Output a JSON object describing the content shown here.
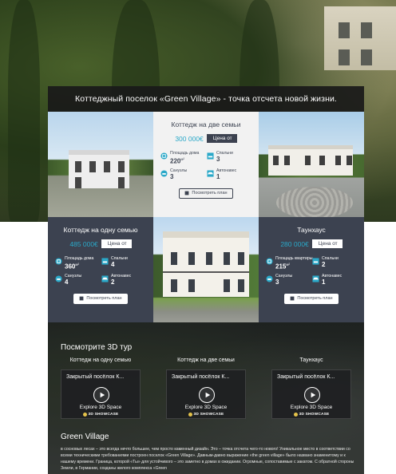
{
  "banner": {
    "title": "Коттеджный поселок «Green Village» - точка отсчета новой жизни."
  },
  "cards": [
    {
      "title": "Коттедж на две семьи",
      "price": "300 000€",
      "price_label": "Цена от",
      "specs": [
        {
          "label": "Площадь дома",
          "value": "220",
          "unit": "м²",
          "icon": "area-icon"
        },
        {
          "label": "Спальни",
          "value": "3",
          "unit": "",
          "icon": "bed-icon"
        },
        {
          "label": "Санузлы",
          "value": "3",
          "unit": "",
          "icon": "bath-icon"
        },
        {
          "label": "Автонавес",
          "value": "1",
          "unit": "",
          "icon": "car-icon"
        }
      ],
      "button": "Посмотреть план"
    },
    {
      "title": "Коттедж на одну семью",
      "price": "485 000€",
      "price_label": "Цена от",
      "specs": [
        {
          "label": "Площадь дома",
          "value": "360",
          "unit": "м²",
          "icon": "area-icon"
        },
        {
          "label": "Спальни",
          "value": "4",
          "unit": "",
          "icon": "bed-icon"
        },
        {
          "label": "Санузлы",
          "value": "4",
          "unit": "",
          "icon": "bath-icon"
        },
        {
          "label": "Автонавес",
          "value": "2",
          "unit": "",
          "icon": "car-icon"
        }
      ],
      "button": "Посмотреть план"
    },
    {
      "title": "Таунхаус",
      "price": "280 000€",
      "price_label": "Цена от",
      "specs": [
        {
          "label": "Площадь квартиры",
          "value": "215",
          "unit": "м²",
          "icon": "area-icon"
        },
        {
          "label": "Спальни",
          "value": "2",
          "unit": "",
          "icon": "bed-icon"
        },
        {
          "label": "Санузлы",
          "value": "3",
          "unit": "",
          "icon": "bath-icon"
        },
        {
          "label": "Автонавес",
          "value": "1",
          "unit": "",
          "icon": "car-icon"
        }
      ],
      "button": "Посмотреть план"
    }
  ],
  "tour": {
    "heading": "Посмотрите 3D тур",
    "items": [
      {
        "title": "Коттедж на одну семью",
        "card_title": "Закрытый посёлок К...",
        "explore": "Explore 3D Space",
        "badge": "3D SHOWCASE"
      },
      {
        "title": "Коттедж на две семьи",
        "card_title": "Закрытый посёлок К...",
        "explore": "Explore 3D Space",
        "badge": "3D SHOWCASE"
      },
      {
        "title": "Таунхаус",
        "card_title": "Закрытый посёлок К...",
        "explore": "Explore 3D Space",
        "badge": "3D SHOWCASE"
      }
    ]
  },
  "about": {
    "title": "Green Village",
    "text": "в сосновых лесах – это всегда нечто большее, чем просто каменный дизайн. Это – точка отсчета чего-то нового! Уникальное место в соответствии со всеми техническими требованиями построен поселок «Green Village». Давным-давно выражение «the green village» было названо знаменитому и к нашему времени. Граница, которой «Ты» для устойчивого – это заметно в домах в ожидании. Огромные, сопоставимые с закатом. С обратной стороны Земли, в Германии, созданы жилого комплекса «Green"
  },
  "colors": {
    "accent": "#2aa8c8",
    "panel_dark": "#3c4250",
    "panel_light": "#f2f2f2",
    "banner": "#191919"
  }
}
